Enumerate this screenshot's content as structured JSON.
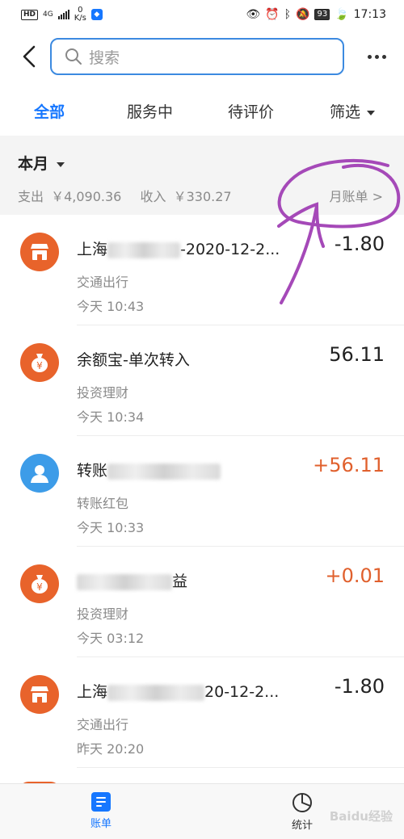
{
  "status_bar": {
    "hd": "HD",
    "network": "4G",
    "speed_value": "0",
    "speed_unit": "K/s",
    "battery": "93",
    "time": "17:13"
  },
  "search": {
    "placeholder": "搜索"
  },
  "tabs": [
    {
      "label": "全部",
      "active": true
    },
    {
      "label": "服务中",
      "active": false
    },
    {
      "label": "待评价",
      "active": false
    },
    {
      "label": "筛选",
      "active": false
    }
  ],
  "month": {
    "title": "本月",
    "expense_label": "支出",
    "expense_value": "￥4,090.36",
    "income_label": "收入",
    "income_value": "￥330.27",
    "bill_link": "月账单 >"
  },
  "transactions": [
    {
      "title_prefix": "上海",
      "title_suffix": "-2020-12-2...",
      "category": "交通出行",
      "time": "今天  10:43",
      "amount": "-1.80",
      "type": "expense",
      "icon": "store-icon",
      "color": "#e8632b"
    },
    {
      "title_prefix": "余额宝-单次转入",
      "title_suffix": "",
      "category": "投资理财",
      "time": "今天  10:34",
      "amount": "56.11",
      "type": "neutral",
      "icon": "money-bag-icon",
      "color": "#e8632b"
    },
    {
      "title_prefix": "转账",
      "title_suffix": "",
      "category": "转账红包",
      "time": "今天  10:33",
      "amount": "+56.11",
      "type": "income",
      "icon": "person-icon",
      "color": "#3d9ce8"
    },
    {
      "title_prefix": "",
      "title_suffix": "益",
      "category": "投资理财",
      "time": "今天  03:12",
      "amount": "+0.01",
      "type": "income",
      "icon": "money-bag-icon",
      "color": "#e8632b"
    },
    {
      "title_prefix": "上海",
      "title_suffix": "20-12-2...",
      "category": "交通出行",
      "time": "昨天  20:20",
      "amount": "-1.80",
      "type": "expense",
      "icon": "store-icon",
      "color": "#e8632b"
    }
  ],
  "bottom_nav": {
    "bill_label": "账单",
    "stats_label": "统计"
  },
  "watermark": "Baidu经验"
}
